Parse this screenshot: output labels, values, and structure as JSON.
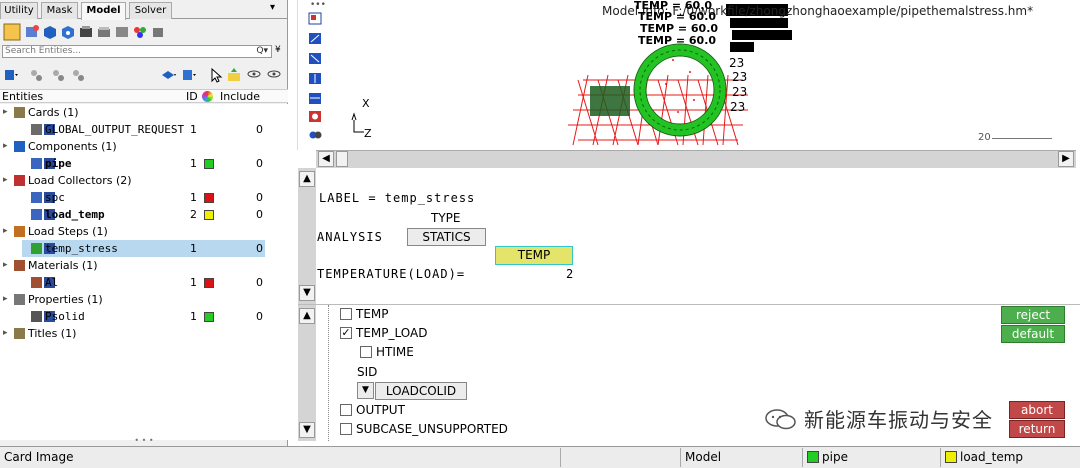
{
  "tabs": [
    {
      "label": "Utility",
      "active": false
    },
    {
      "label": "Mask",
      "active": false
    },
    {
      "label": "Model",
      "active": true
    },
    {
      "label": "Solver",
      "active": false
    }
  ],
  "search": {
    "placeholder": "Search Entities..."
  },
  "tree_header": {
    "entities": "Entities",
    "id": "ID",
    "include": "Include"
  },
  "tree": [
    {
      "label": "Cards (1)",
      "level": 0,
      "icon": "card-icon"
    },
    {
      "label": "GLOBAL_OUTPUT_REQUEST",
      "level": 1,
      "id": "1",
      "include": "0",
      "icon": "card-item-icon"
    },
    {
      "label": "Components (1)",
      "level": 0,
      "icon": "component-icon"
    },
    {
      "label": "pipe",
      "level": 1,
      "id": "1",
      "include": "0",
      "color": "#22cc22",
      "bold": true,
      "icon": "component-item-icon"
    },
    {
      "label": "Load Collectors (2)",
      "level": 0,
      "icon": "load-collector-icon"
    },
    {
      "label": "spc",
      "level": 1,
      "id": "1",
      "include": "0",
      "color": "#dd1111",
      "icon": "load-collector-item-icon"
    },
    {
      "label": "load_temp",
      "level": 1,
      "id": "2",
      "include": "0",
      "color": "#eeee00",
      "bold": true,
      "icon": "load-collector-item-icon"
    },
    {
      "label": "Load Steps (1)",
      "level": 0,
      "icon": "load-step-icon"
    },
    {
      "label": "temp_stress",
      "level": 1,
      "id": "1",
      "include": "0",
      "selected": true,
      "icon": "load-step-item-icon"
    },
    {
      "label": "Materials (1)",
      "level": 0,
      "icon": "material-icon"
    },
    {
      "label": "Al",
      "level": 1,
      "id": "1",
      "include": "0",
      "color": "#dd1111",
      "icon": "material-item-icon"
    },
    {
      "label": "Properties (1)",
      "level": 0,
      "icon": "property-icon"
    },
    {
      "label": "Psolid",
      "level": 1,
      "id": "1",
      "include": "0",
      "color": "#22cc22",
      "icon": "property-item-icon"
    },
    {
      "label": "Titles (1)",
      "level": 0,
      "icon": "title-icon"
    }
  ],
  "graphics": {
    "model_info": "Model Info: F:/0/workfile/zhongzhonghaoexample/pipethemalstress.hm*",
    "load_labels": [
      "TEMP = 60.0",
      "TEMP = 60.0",
      "TEMP = 60.0",
      "TEMP = 60.0"
    ],
    "node_labels": [
      "23",
      "23",
      "23",
      "23"
    ],
    "axis_x": "X",
    "axis_z": "Z",
    "scale_label": "20"
  },
  "card": {
    "label_line": "LABEL = temp_stress",
    "type_caption": "TYPE",
    "analysis_label": "ANALYSIS",
    "analysis_value": "STATICS",
    "temp_button": "TEMP",
    "temperature_label": "TEMPERATURE(LOAD)=",
    "temperature_value": "2"
  },
  "options": {
    "temp": {
      "label": "TEMP",
      "checked": false
    },
    "temp_load": {
      "label": "TEMP_LOAD",
      "checked": true
    },
    "htime": {
      "label": "HTIME",
      "checked": false
    },
    "sid_label": "SID",
    "loadcolid": "LOADCOLID",
    "output": {
      "label": "OUTPUT",
      "checked": false
    },
    "subcase_unsupported": {
      "label": "SUBCASE_UNSUPPORTED",
      "checked": false
    },
    "reject": "reject",
    "default": "default",
    "abort": "abort",
    "return": "return"
  },
  "watermark": "新能源车振动与安全",
  "status": {
    "left": "Card Image",
    "mode": "Model",
    "component": "pipe",
    "component_color": "#22cc22",
    "load_collector": "load_temp",
    "load_collector_color": "#eeee00"
  }
}
